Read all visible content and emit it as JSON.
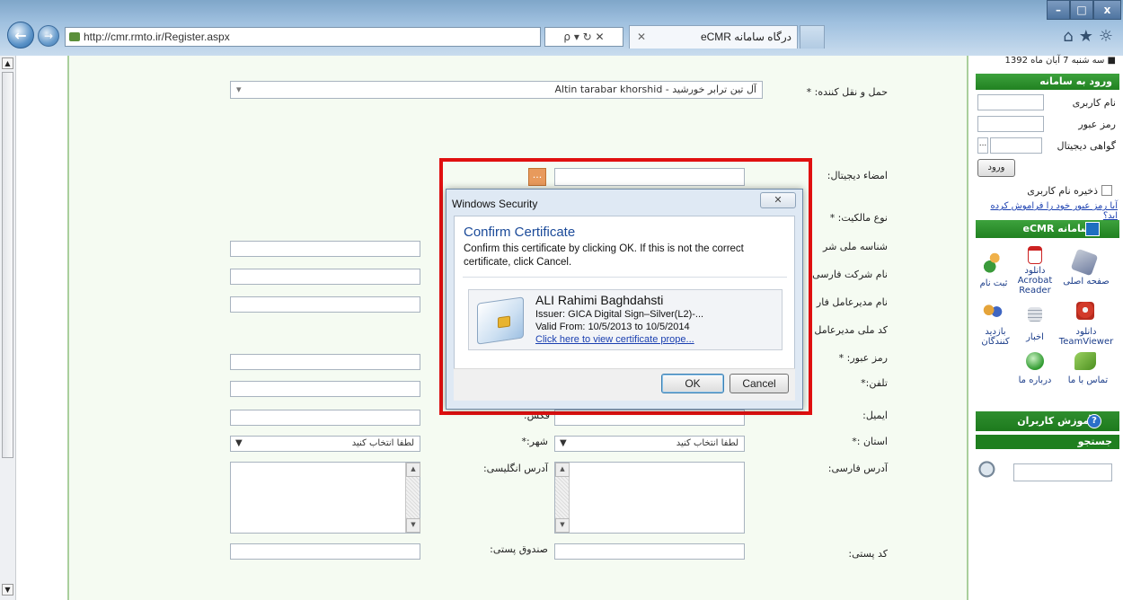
{
  "browser": {
    "address": "http://cmr.rmto.ir/Register.aspx",
    "address_controls": "ρ ▾ ↻ ✕",
    "tab_title": "درگاه سامانه eCMR",
    "tab_close": "✕",
    "win_min": "–",
    "win_max": "□",
    "win_close": "x",
    "toolbar_icons": "⌂★☼"
  },
  "form": {
    "carrier_label": "حمل و نقل کننده: *",
    "carrier_value": "آل تین ترابر خورشید  -  Altin tarabar khorshid",
    "signature_label": "امضاء دیجیتال:",
    "signature_btn": "...",
    "ownership_label": "نوع مالکیت: *",
    "national_id_label": "شناسه ملی شر",
    "company_fa_label": "نام شرکت فارسی",
    "ceo_fa_label": "نام مدیرعامل فار",
    "ceo_code_label": "کد ملی مدیرعامل",
    "password_label": "رمز عبور: *",
    "phone_label": "تلفن:*",
    "fax_label": "فکس:",
    "email_label": "ایمیل:",
    "province_label": "استان :*",
    "province_value": "لطفا انتخاب کنید",
    "city_label": "شهر:*",
    "city_value": "لطفا انتخاب کنید",
    "addr_fa_label": "آدرس فارسی:",
    "addr_en_label": "آدرس انگلیسی:",
    "postal_label": "کد پستی:",
    "pobox_label": "صندوق پستی:"
  },
  "sidebar": {
    "date": "■ سه شنبه 7 آبان ماه 1392",
    "login_head": "ورود به سامانه",
    "username_label": "نام کاربری",
    "password_label": "رمز عبور",
    "cert_label": "گواهی دیجیتال",
    "cert_btn": "...",
    "login_btn": "ورود",
    "remember_label": "ذخیره نام کاربری",
    "forgot_link": "آیا رمز عبور خود را فراموش کرده اید؟",
    "ecmr_head": "سامانه eCMR",
    "icons": {
      "home": "صفحه اصلی",
      "acrobat": "دانلود Acrobat Reader",
      "register": "ثبت نام",
      "teamviewer": "دانلود TeamViewer",
      "news": "اخبار",
      "visitors": "بازدید کنندگان",
      "contact": "تماس با ما",
      "about": "درباره ما"
    },
    "training_head": "آموزش کاربران",
    "search_head": "جستجو"
  },
  "dialog": {
    "title": "Windows Security",
    "close": "✕",
    "heading": "Confirm Certificate",
    "message": "Confirm this certificate by clicking OK. If this is not the correct certificate, click Cancel.",
    "cert_name": "ALI Rahimi Baghdahsti",
    "issuer": "Issuer: GICA Digital Sign–Silver(L2)-...",
    "valid": "Valid From: 10/5/2013 to 10/5/2014",
    "link": "Click here to view certificate prope...",
    "ok": "OK",
    "cancel": "Cancel"
  }
}
